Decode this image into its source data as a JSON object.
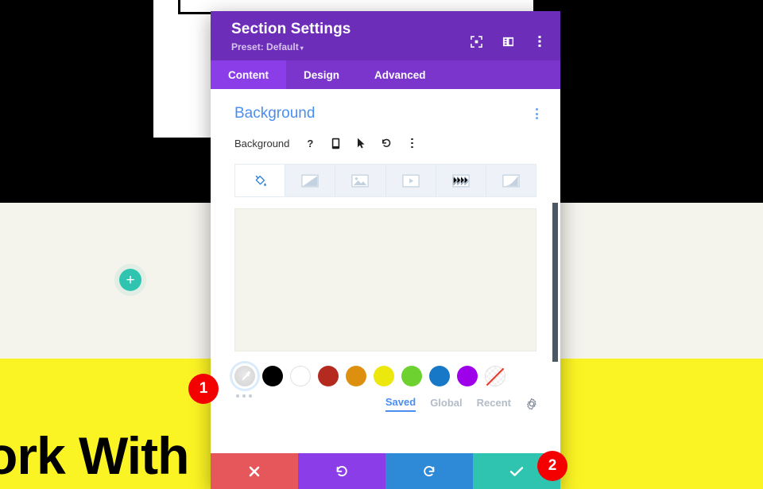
{
  "background_page": {
    "hero_text": "ork With",
    "add_button_label": "+",
    "add_button_color": "#2ec4b0",
    "yellow_band_color": "#fbf424",
    "cream_band_color": "#f4f3ec"
  },
  "modal": {
    "title": "Section Settings",
    "preset_label": "Preset: Default",
    "preset_caret": "▾",
    "header_icons": [
      {
        "name": "fullscreen-icon",
        "title": "Expand"
      },
      {
        "name": "layout-panel-icon",
        "title": "Layout"
      },
      {
        "name": "more-vertical-icon",
        "title": "More"
      }
    ],
    "tabs": [
      {
        "label": "Content",
        "active": true
      },
      {
        "label": "Design",
        "active": false
      },
      {
        "label": "Advanced",
        "active": false
      }
    ],
    "section": {
      "title": "Background",
      "title_color": "#4a8ef0",
      "options_icon": "more-vertical-icon"
    },
    "field": {
      "label": "Background",
      "icons": [
        {
          "name": "help-icon",
          "glyph": "?"
        },
        {
          "name": "responsive-mobile-icon",
          "glyph": "mobile"
        },
        {
          "name": "hover-cursor-icon",
          "glyph": "cursor"
        },
        {
          "name": "reset-undo-icon",
          "glyph": "undo"
        },
        {
          "name": "more-vertical-icon",
          "glyph": "dots"
        }
      ]
    },
    "background_types": [
      {
        "name": "background-color-tab",
        "icon": "paint-bucket-icon",
        "active": true
      },
      {
        "name": "background-gradient-tab",
        "icon": "gradient-icon",
        "active": false
      },
      {
        "name": "background-image-tab",
        "icon": "image-icon",
        "active": false
      },
      {
        "name": "background-video-tab",
        "icon": "video-icon",
        "active": false
      },
      {
        "name": "background-pattern-tab",
        "icon": "pattern-icon",
        "active": false
      },
      {
        "name": "background-mask-tab",
        "icon": "mask-icon",
        "active": false
      }
    ],
    "preview": {
      "fill_color": "#f4f3ec"
    },
    "swatches": [
      {
        "name": "color-picker-swatch",
        "type": "picker",
        "color": "#dddddd",
        "selected": true
      },
      {
        "name": "swatch-black",
        "type": "solid",
        "color": "#000000"
      },
      {
        "name": "swatch-white",
        "type": "white",
        "color": "#ffffff"
      },
      {
        "name": "swatch-red",
        "type": "solid",
        "color": "#b42a1f"
      },
      {
        "name": "swatch-orange",
        "type": "solid",
        "color": "#dd9010"
      },
      {
        "name": "swatch-yellow",
        "type": "solid",
        "color": "#ece80e"
      },
      {
        "name": "swatch-green",
        "type": "solid",
        "color": "#6dd130"
      },
      {
        "name": "swatch-blue",
        "type": "solid",
        "color": "#1878c8"
      },
      {
        "name": "swatch-purple",
        "type": "solid",
        "color": "#9e00ea"
      },
      {
        "name": "swatch-transparent",
        "type": "transparent",
        "color": "transparent"
      }
    ],
    "palette_tabs": [
      {
        "label": "Saved",
        "active": true
      },
      {
        "label": "Global",
        "active": false
      },
      {
        "label": "Recent",
        "active": false
      }
    ],
    "palette_settings_icon": "gear-icon",
    "footer_buttons": [
      {
        "name": "cancel-button",
        "icon": "close-icon",
        "color": "#e5575a"
      },
      {
        "name": "undo-button",
        "icon": "undo-icon",
        "color": "#8b3ee8"
      },
      {
        "name": "redo-button",
        "icon": "redo-icon",
        "color": "#2e8ad6"
      },
      {
        "name": "save-button",
        "icon": "checkmark-icon",
        "color": "#2ec4b0"
      }
    ]
  },
  "callouts": [
    {
      "label": "1"
    },
    {
      "label": "2"
    }
  ]
}
